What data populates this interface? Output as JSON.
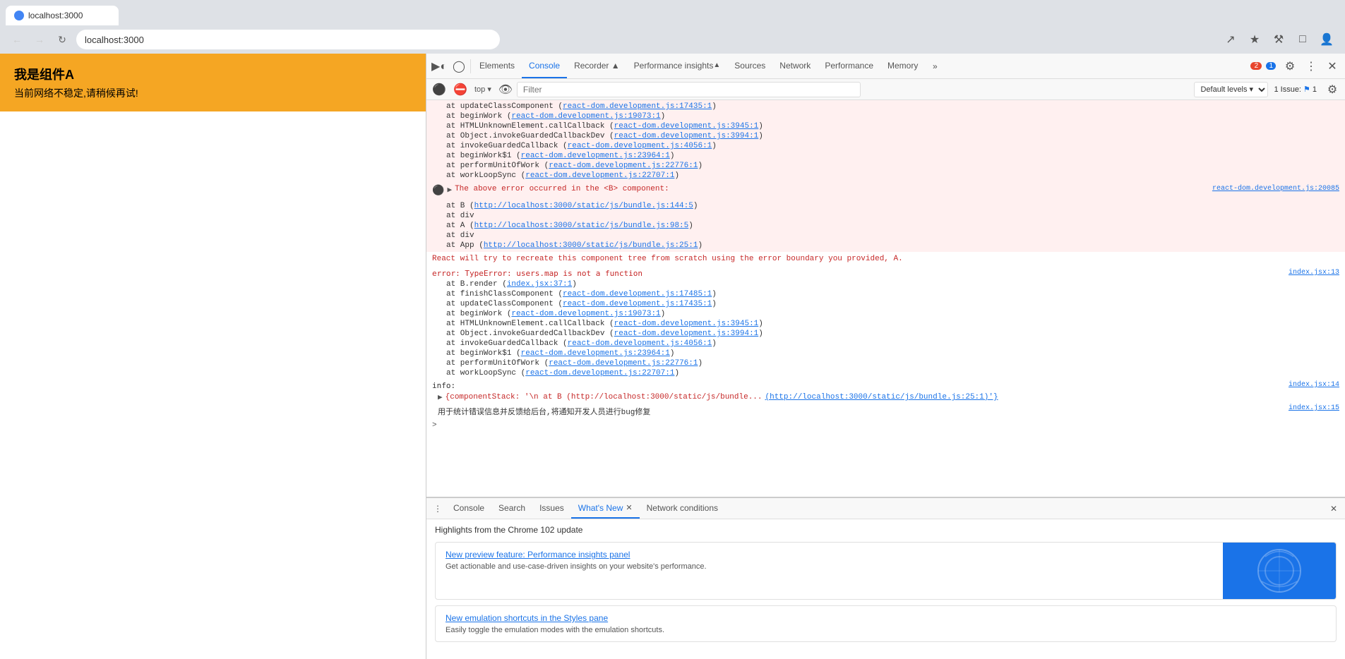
{
  "browser": {
    "tab_title": "localhost:3000",
    "address": "localhost:3000",
    "back_disabled": true,
    "forward_disabled": true
  },
  "webpage": {
    "component_title": "我是组件A",
    "component_subtitle": "当前网络不稳定,请稍候再试!"
  },
  "devtools": {
    "tabs": [
      {
        "label": "Elements",
        "active": false
      },
      {
        "label": "Console",
        "active": true
      },
      {
        "label": "Recorder ▲",
        "active": false
      },
      {
        "label": "Performance insights",
        "active": false
      },
      {
        "label": "Sources",
        "active": false
      },
      {
        "label": "Network",
        "active": false
      },
      {
        "label": "Performance",
        "active": false
      },
      {
        "label": "Memory",
        "active": false
      }
    ],
    "error_badge": "2",
    "warning_badge": "1",
    "console_toolbar": {
      "filter_placeholder": "Filter",
      "level_label": "Default levels",
      "issue_text": "1 Issue:",
      "issue_count": "1"
    },
    "console_lines": [
      {
        "type": "stack",
        "text": "at updateClassComponent (react-dom.development.js:17435:1)"
      },
      {
        "type": "stack",
        "text": "at beginWork (react-dom.development.js:19073:1)"
      },
      {
        "type": "stack",
        "text": "at HTMLUnknownElement.callCallback (react-dom.development.js:3945:1)"
      },
      {
        "type": "stack",
        "text": "at Object.invokeGuardedCallbackDev (react-dom.development.js:3994:1)"
      },
      {
        "type": "stack",
        "text": "at invokeGuardedCallback (react-dom.development.js:4056:1)"
      },
      {
        "type": "stack",
        "text": "at beginWork$1 (react-dom.development.js:23964:1)"
      },
      {
        "type": "stack",
        "text": "at performUnitOfWork (react-dom.development.js:22776:1)"
      },
      {
        "type": "stack",
        "text": "at workLoopSync (react-dom.development.js:22707:1)"
      }
    ],
    "error_boundary_msg": "▶ The above error occurred in the <B> component:",
    "error_boundary_file": "react-dom.development.js:20085",
    "error_component_stack": [
      {
        "text": "at B (http://localhost:3000/static/js/bundle.js:144:5)"
      },
      {
        "text": "at div"
      },
      {
        "text": "at A (http://localhost:3000/static/js/bundle.js:98:5)"
      },
      {
        "text": "at div"
      },
      {
        "text": "at App (http://localhost:3000/static/js/bundle.js:25:1)"
      }
    ],
    "recovery_msg": "React will try to recreate this component tree from scratch using the error boundary you provided, A.",
    "error_type": "error: TypeError: users.map is not a function",
    "error_file": "index.jsx:13",
    "stack_lines2": [
      {
        "text": "at B.render (index.jsx:37:1)"
      },
      {
        "text": "at finishClassComponent (react-dom.development.js:17485:1)"
      },
      {
        "text": "at updateClassComponent (react-dom.development.js:17435:1)"
      },
      {
        "text": "at beginWork (react-dom.development.js:19073:1)"
      },
      {
        "text": "at HTMLUnknownElement.callCallback (react-dom.development.js:3945:1)"
      },
      {
        "text": "at Object.invokeGuardedCallbackDev (react-dom.development.js:3994:1)"
      },
      {
        "text": "at invokeGuardedCallback (react-dom.development.js:4056:1)"
      },
      {
        "text": "at beginWork$1 (react-dom.development.js:23964:1)"
      },
      {
        "text": "at performUnitOfWork (react-dom.development.js:22776:1)"
      },
      {
        "text": "at workLoopSync (react-dom.development.js:22707:1)"
      }
    ],
    "info_label": "info:",
    "info_file": "index.jsx:14",
    "component_stack_label": "▶ {componentStack: '\\n    at B (http://localhost:3000/static/js/bundle...",
    "component_stack_file": "(http://localhost:3000/static/js/bundle.js:25:1)'}",
    "chinese_log": "用于统计错误信息并反馈给后台,将通知开发人员进行bug修复",
    "chinese_log_file": "index.jsx:15",
    "expand_arrow": ">"
  },
  "bottom_panel": {
    "tabs": [
      {
        "label": "Console",
        "active": false
      },
      {
        "label": "Search",
        "active": false
      },
      {
        "label": "Issues",
        "active": false
      },
      {
        "label": "What's New",
        "active": true
      },
      {
        "label": "Network conditions",
        "active": false
      }
    ],
    "whats_new": {
      "header": "Highlights from the Chrome 102 update",
      "cards": [
        {
          "title": "New preview feature: Performance insights panel",
          "desc": "Get actionable and use-case-driven insights on your website's performance.",
          "has_image": true
        },
        {
          "title": "New emulation shortcuts in the Styles pane",
          "desc": "Easily toggle the emulation modes with the emulation shortcuts.",
          "has_image": false
        }
      ]
    }
  }
}
